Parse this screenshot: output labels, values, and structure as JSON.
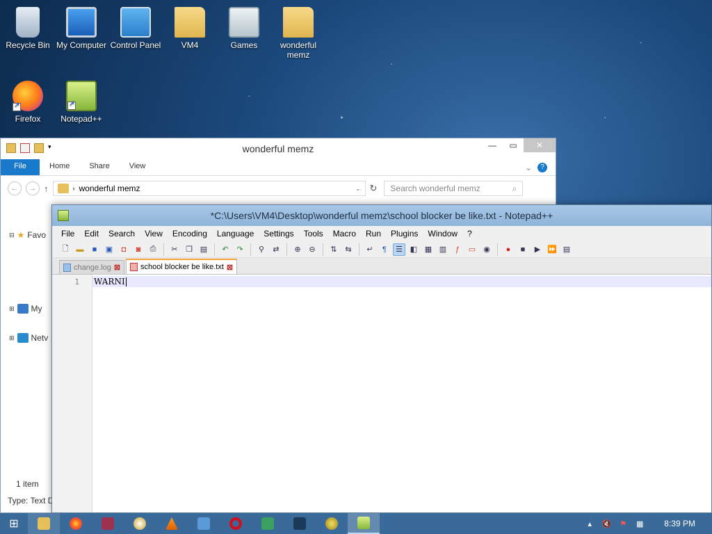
{
  "desktop": {
    "icons": [
      {
        "label": "Recycle Bin",
        "icon": "recycle-bin-icon"
      },
      {
        "label": "My Computer",
        "icon": "computer-icon"
      },
      {
        "label": "Control Panel",
        "icon": "control-panel-icon"
      },
      {
        "label": "VM4",
        "icon": "user-folder-icon"
      },
      {
        "label": "Games",
        "icon": "games-icon"
      },
      {
        "label": "wonderful memz",
        "icon": "folder-icon"
      },
      {
        "label": "Firefox",
        "icon": "firefox-icon"
      },
      {
        "label": "Notepad++",
        "icon": "notepadpp-icon"
      }
    ]
  },
  "explorer": {
    "title": "wonderful memz",
    "ribbon_tabs": [
      "File",
      "Home",
      "Share",
      "View"
    ],
    "address": "wonderful memz",
    "search_placeholder": "Search wonderful memz",
    "tree": [
      "Favo",
      "My",
      "Netv"
    ],
    "status": "1 item",
    "details": "Type: Text D"
  },
  "notepad": {
    "title": "*C:\\Users\\VM4\\Desktop\\wonderful memz\\school blocker be like.txt - Notepad++",
    "menus": [
      "File",
      "Edit",
      "Search",
      "View",
      "Encoding",
      "Language",
      "Settings",
      "Tools",
      "Macro",
      "Run",
      "Plugins",
      "Window",
      "?"
    ],
    "tabs": [
      {
        "label": "change.log",
        "active": false
      },
      {
        "label": "school blocker be like.txt",
        "active": true
      }
    ],
    "line_number": "1",
    "content": "WARNI"
  },
  "taskbar": {
    "clock": "8:39 PM",
    "accent": "#3a6a9a"
  }
}
